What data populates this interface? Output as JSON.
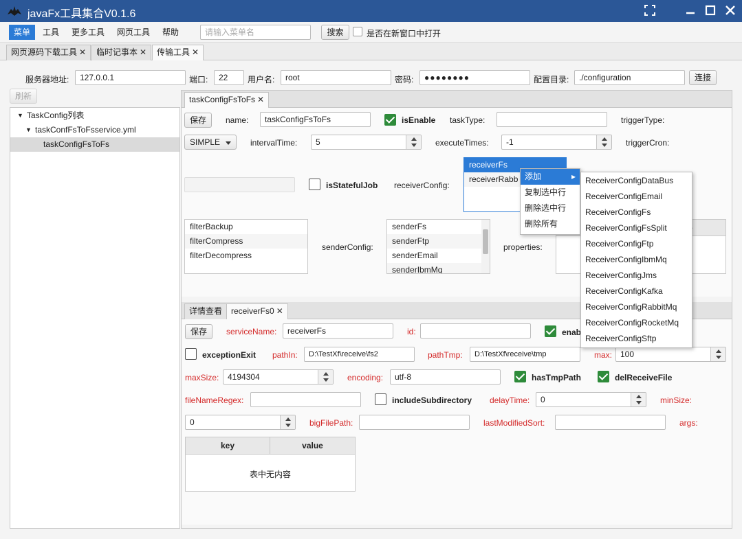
{
  "window": {
    "title": "javaFx工具集合V0.1.6"
  },
  "menubar": {
    "items": [
      "菜单",
      "工具",
      "更多工具",
      "网页工具",
      "帮助"
    ],
    "search_placeholder": "请输入菜单名",
    "search_button": "搜索",
    "new_window_label": "是否在新窗口中打开"
  },
  "outer_tabs": [
    {
      "label": "网页源码下载工具",
      "close": "✕"
    },
    {
      "label": "临时记事本",
      "close": "✕"
    },
    {
      "label": "传输工具",
      "close": "✕"
    }
  ],
  "connection": {
    "server_label": "服务器地址:",
    "server_value": "127.0.0.1",
    "port_label": "端口:",
    "port_value": "22",
    "user_label": "用户名:",
    "user_value": "root",
    "password_label": "密码:",
    "password_value": "●●●●●●●●",
    "config_label": "配置目录:",
    "config_value": "./configuration",
    "connect_button": "连接"
  },
  "refresh_button": "刷新",
  "tree": {
    "items": [
      {
        "label": "TaskConfig列表",
        "arrow": "▼"
      },
      {
        "label": "taskConfFsToFsservice.yml",
        "arrow": "▼"
      },
      {
        "label": "taskConfigFsToFs",
        "arrow": ""
      }
    ]
  },
  "task": {
    "tab_label": "taskConfigFsToFs",
    "tab_close": "✕",
    "save_button": "保存",
    "name_label": "name:",
    "name_value": "taskConfigFsToFs",
    "is_enable_label": "isEnable",
    "task_type_label": "taskType:",
    "task_type_value": "",
    "trigger_type_label": "triggerType:",
    "trigger_select": "SIMPLE",
    "interval_label": "intervalTime:",
    "interval_value": "5",
    "execute_label": "executeTimes:",
    "execute_value": "-1",
    "trigger_cron_label": "triggerCron:",
    "is_stateful_label": "isStatefulJob",
    "receiver_config_label": "receiverConfig:",
    "receiver_list": [
      "receiverFs",
      "receiverRabb"
    ],
    "filter_list": [
      "filterBackup",
      "filterCompress",
      "filterDecompress"
    ],
    "sender_config_label": "senderConfig:",
    "sender_list": [
      "senderFs",
      "senderFtp",
      "senderEmail",
      "senderIbmMq"
    ],
    "properties_label": "properties:",
    "properties_header_partial": "e"
  },
  "context_menu": {
    "items": [
      "添加",
      "复制选中行",
      "删除选中行",
      "删除所有"
    ],
    "submenu_arrow": "▸",
    "submenu": [
      "ReceiverConfigDataBus",
      "ReceiverConfigEmail",
      "ReceiverConfigFs",
      "ReceiverConfigFsSplit",
      "ReceiverConfigFtp",
      "ReceiverConfigIbmMq",
      "ReceiverConfigJms",
      "ReceiverConfigKafka",
      "ReceiverConfigRabbitMq",
      "ReceiverConfigRocketMq",
      "ReceiverConfigSftp"
    ]
  },
  "detail": {
    "tabs": [
      {
        "label": "详情查看",
        "close": ""
      },
      {
        "label": "receiverFs0",
        "close": "✕"
      }
    ],
    "save_button": "保存",
    "service_name_label": "serviceName:",
    "service_name_value": "receiverFs",
    "id_label": "id:",
    "id_value": "",
    "enable_label_partial": "enab",
    "exception_exit_label": "exceptionExit",
    "path_in_label": "pathIn:",
    "path_in_value": "D:\\TestXf\\receive\\fs2",
    "path_tmp_label": "pathTmp:",
    "path_tmp_value": "D:\\TestXf\\receive\\tmp",
    "max_label": "max:",
    "max_value": "100",
    "max_size_label": "maxSize:",
    "max_size_value": "4194304",
    "encoding_label": "encoding:",
    "encoding_value": "utf-8",
    "has_tmp_path_label": "hasTmpPath",
    "del_receive_file_label": "delReceiveFile",
    "file_name_regex_label": "fileNameRegex:",
    "file_name_regex_value": "",
    "include_subdir_label": "includeSubdirectory",
    "delay_time_label": "delayTime:",
    "delay_time_value": "0",
    "min_size_label": "minSize:",
    "min_size_value": "0",
    "big_file_path_label": "bigFilePath:",
    "big_file_path_value": "",
    "last_modified_label": "lastModifiedSort:",
    "last_modified_value": "",
    "args_label": "args:",
    "table": {
      "headers": [
        "key",
        "value"
      ],
      "empty_text": "表中无内容"
    }
  }
}
